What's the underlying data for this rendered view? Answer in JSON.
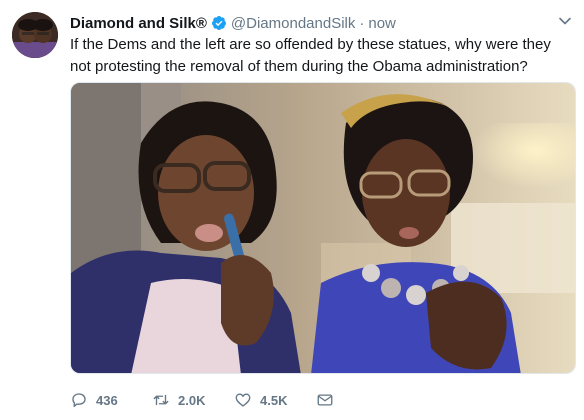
{
  "tweet": {
    "display_name": "Diamond and Silk®",
    "handle": "@DiamondandSilk",
    "separator": "·",
    "timestamp": "now",
    "text": "If the Dems and the left are so offended by these statues, why were they not protesting the removal of them during the Obama administration?",
    "verified_icon": "verified-badge-icon",
    "menu_icon": "chevron-down-icon",
    "accent_color": "#1da1f2"
  },
  "actions": {
    "reply": {
      "icon": "reply-icon",
      "count": "436"
    },
    "retweet": {
      "icon": "retweet-icon",
      "count": "2.0K"
    },
    "like": {
      "icon": "heart-icon",
      "count": "4.5K"
    },
    "message": {
      "icon": "envelope-icon"
    }
  }
}
